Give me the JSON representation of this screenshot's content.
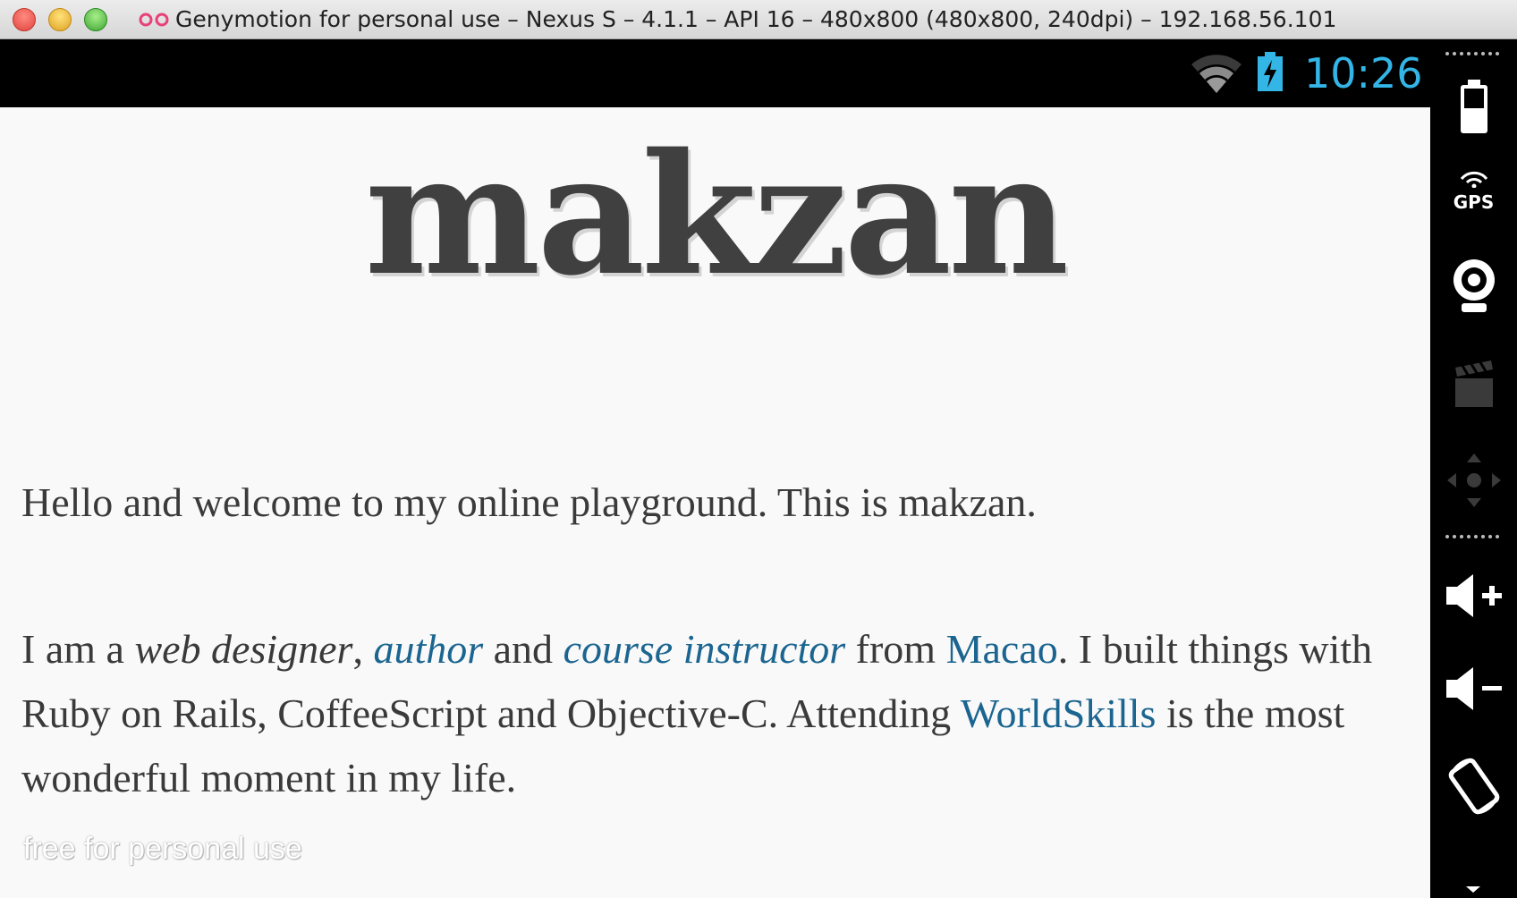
{
  "window": {
    "title": "Genymotion for personal use – Nexus S – 4.1.1 – API 16 – 480x800 (480x800, 240dpi) – 192.168.56.101"
  },
  "status_bar": {
    "time": "10:26",
    "icons": [
      "wifi-icon",
      "battery-charging-icon"
    ]
  },
  "page": {
    "site_title": "makzan",
    "intro": "Hello and welcome to my online playground. This is makzan.",
    "bio": {
      "t1": "I am a ",
      "role": "web designer",
      "t2": ", ",
      "link_author": "author",
      "t3": " and ",
      "link_course": "course instructor",
      "t4": " from ",
      "link_macao": "Macao",
      "t5": ". I built things with Ruby on Rails, CoffeeScript and Objective-C. Attending ",
      "link_worldskills": "WorldSkills",
      "t6": " is the most wonderful moment in my life."
    },
    "link_color": "#1b6590"
  },
  "watermark": "free for personal use",
  "side_panel": {
    "gps_label": "GPS",
    "icons": [
      "battery-icon",
      "gps-icon",
      "camera-icon",
      "video-capture-icon",
      "dpad-icon",
      "volume-up-icon",
      "volume-down-icon",
      "rotate-icon"
    ]
  },
  "colors": {
    "status_clock": "#33b5e5",
    "content_bg": "#f9f9f9",
    "text": "#3a3a3a"
  }
}
